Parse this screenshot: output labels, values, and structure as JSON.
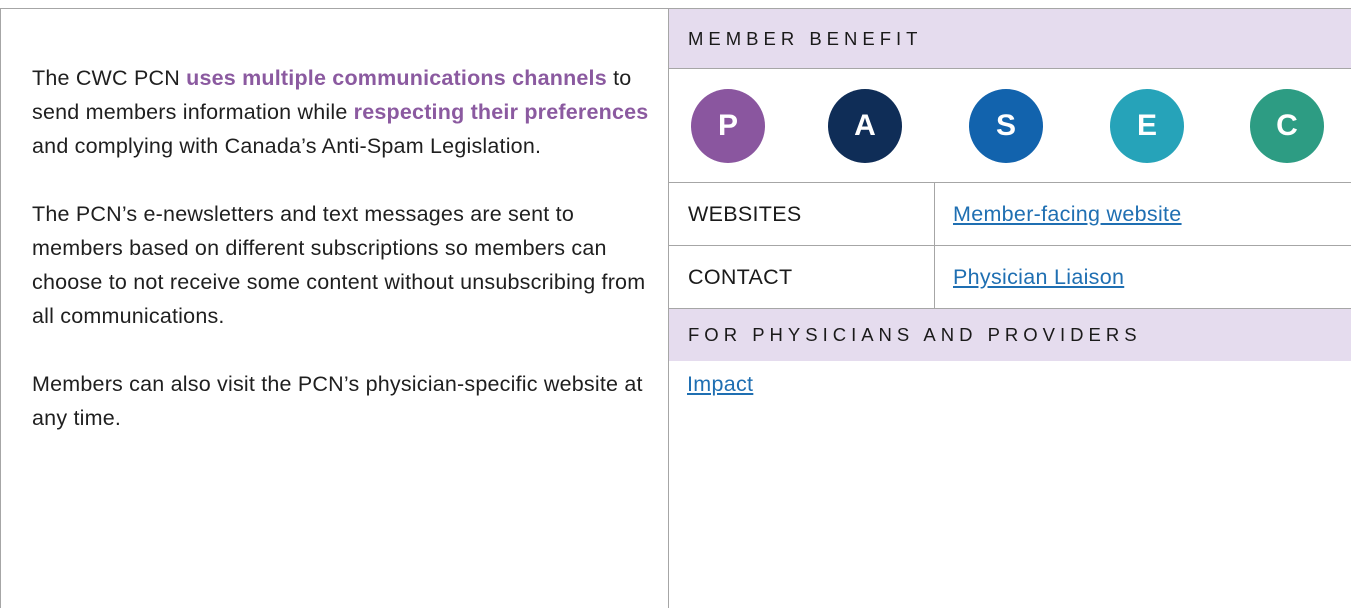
{
  "left": {
    "paragraph1": {
      "pre": "The CWC PCN ",
      "hl1": "uses multiple communications channels",
      "mid": " to send members information while ",
      "hl2": "respecting their preferences",
      "post": " and complying with Canada’s Anti-Spam Legislation."
    },
    "paragraph2": "The PCN’s e-newsletters and text messages are sent to members based on different subscriptions so members can choose to not receive some content without unsubscribing from all communications.",
    "paragraph3": "Members can also visit the PCN’s physician-specific website at any time."
  },
  "right": {
    "member_benefit_label": "MEMBER BENEFIT",
    "pasec": [
      {
        "letter": "P",
        "color": "#8a569f"
      },
      {
        "letter": "A",
        "color": "#0f2d57"
      },
      {
        "letter": "S",
        "color": "#1263ad"
      },
      {
        "letter": "E",
        "color": "#26a3b9"
      },
      {
        "letter": "C",
        "color": "#2d9c83"
      }
    ],
    "websites_label": "WEBSITES",
    "websites_link": "Member-facing website",
    "contact_label": "CONTACT",
    "contact_link": "Physician Liaison",
    "physicians_label": "FOR PHYSICIANS AND PROVIDERS",
    "impact_link": "Impact"
  },
  "colors": {
    "highlight": "#8b5aa0",
    "band": "#e5dcee",
    "link": "#1f6fb2"
  }
}
